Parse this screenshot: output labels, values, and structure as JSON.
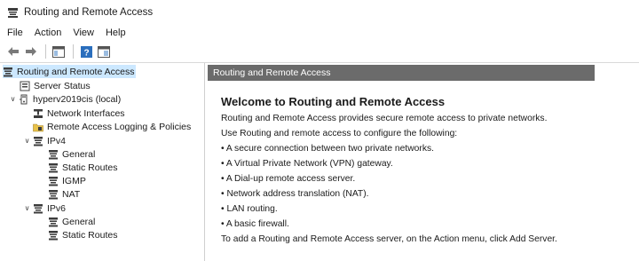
{
  "window": {
    "title": "Routing and Remote Access",
    "icon": "server-icon"
  },
  "menu": [
    "File",
    "Action",
    "View",
    "Help"
  ],
  "toolbar": {
    "buttons": [
      "back-arrow-icon",
      "forward-arrow-icon",
      "show-hide-tree-icon",
      "help-icon",
      "console-tree-icon"
    ]
  },
  "tree": {
    "root": "Routing and Remote Access",
    "server_status": "Server Status",
    "server": "hyperv2019cis (local)",
    "network_interfaces": "Network Interfaces",
    "logging": "Remote Access Logging & Policies",
    "ipv4": "IPv4",
    "ipv4_children": [
      "General",
      "Static Routes",
      "IGMP",
      "NAT"
    ],
    "ipv6": "IPv6",
    "ipv6_children": [
      "General",
      "Static Routes"
    ]
  },
  "pane": {
    "header": "Routing and Remote Access",
    "welcome": "Welcome to Routing and Remote Access",
    "intro": "Routing and Remote Access provides secure remote access to private networks.",
    "configure": "Use Routing and remote access to configure the following:",
    "bullets": [
      "• A secure connection between two private networks.",
      "• A Virtual Private Network (VPN) gateway.",
      "• A Dial-up remote access server.",
      "• Network address translation (NAT).",
      "• LAN routing.",
      "• A basic firewall."
    ],
    "footer": "To add a Routing and Remote Access server, on the Action menu, click Add Server."
  },
  "colors": {
    "header_bar": "#6b6b6b",
    "selection": "#cce8ff",
    "icon_dark": "#3c3c3c",
    "help_blue": "#2a6ebd",
    "folder_yellow": "#e8c24a"
  }
}
